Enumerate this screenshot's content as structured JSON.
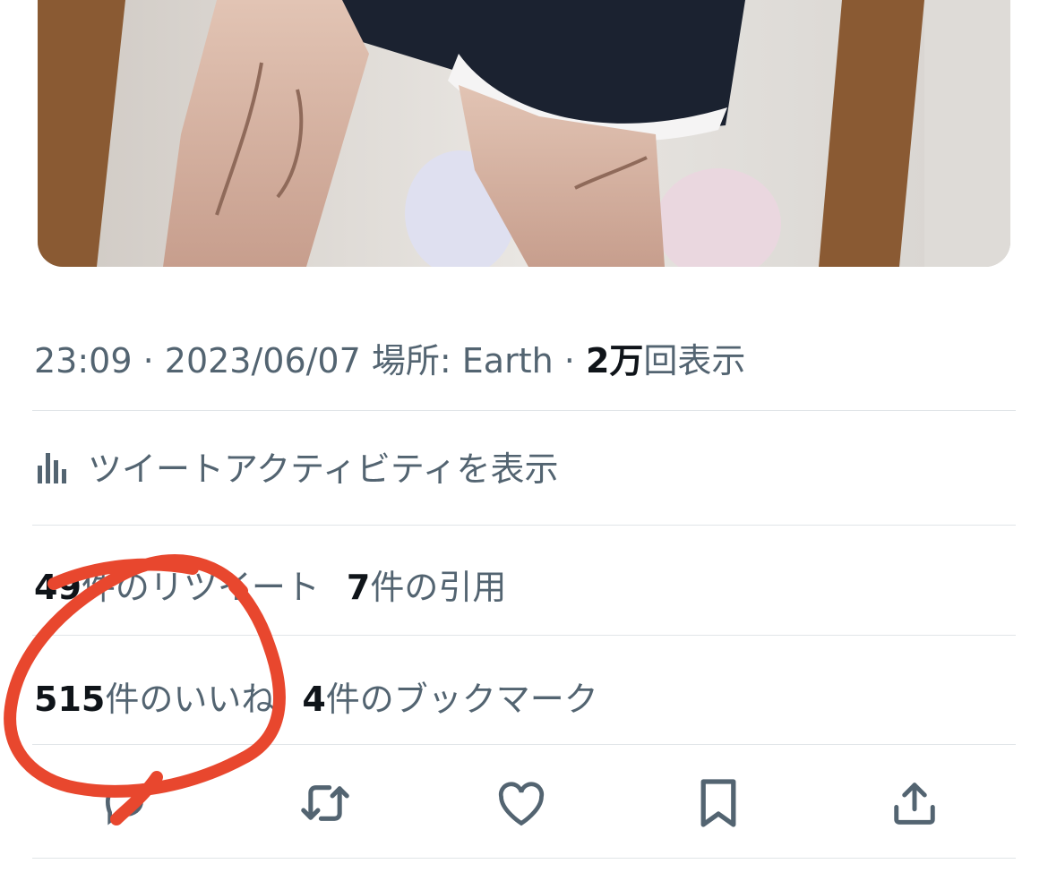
{
  "tweet": {
    "time": "23:09",
    "date": "2023/06/07",
    "location_label": "場所: Earth",
    "views_count": "2万",
    "views_suffix": "回表示",
    "separator": " · "
  },
  "activity_link": {
    "label": "ツイートアクティビティを表示",
    "icon": "bar-chart-icon"
  },
  "stats": {
    "retweets": {
      "count": "49",
      "label": "件のリツイート"
    },
    "quotes": {
      "count": "7",
      "label": "件の引用"
    },
    "likes": {
      "count": "515",
      "label": "件のいいね"
    },
    "bookmarks": {
      "count": "4",
      "label": "件のブックマーク"
    }
  },
  "actions": [
    {
      "icon": "reply-icon"
    },
    {
      "icon": "retweet-icon"
    },
    {
      "icon": "like-icon"
    },
    {
      "icon": "bookmark-icon"
    },
    {
      "icon": "share-icon"
    }
  ],
  "colors": {
    "secondary_text": "#536471",
    "primary_text": "#0f1419",
    "divider": "#e1e5e8",
    "annotation_circle": "#e8472e"
  }
}
